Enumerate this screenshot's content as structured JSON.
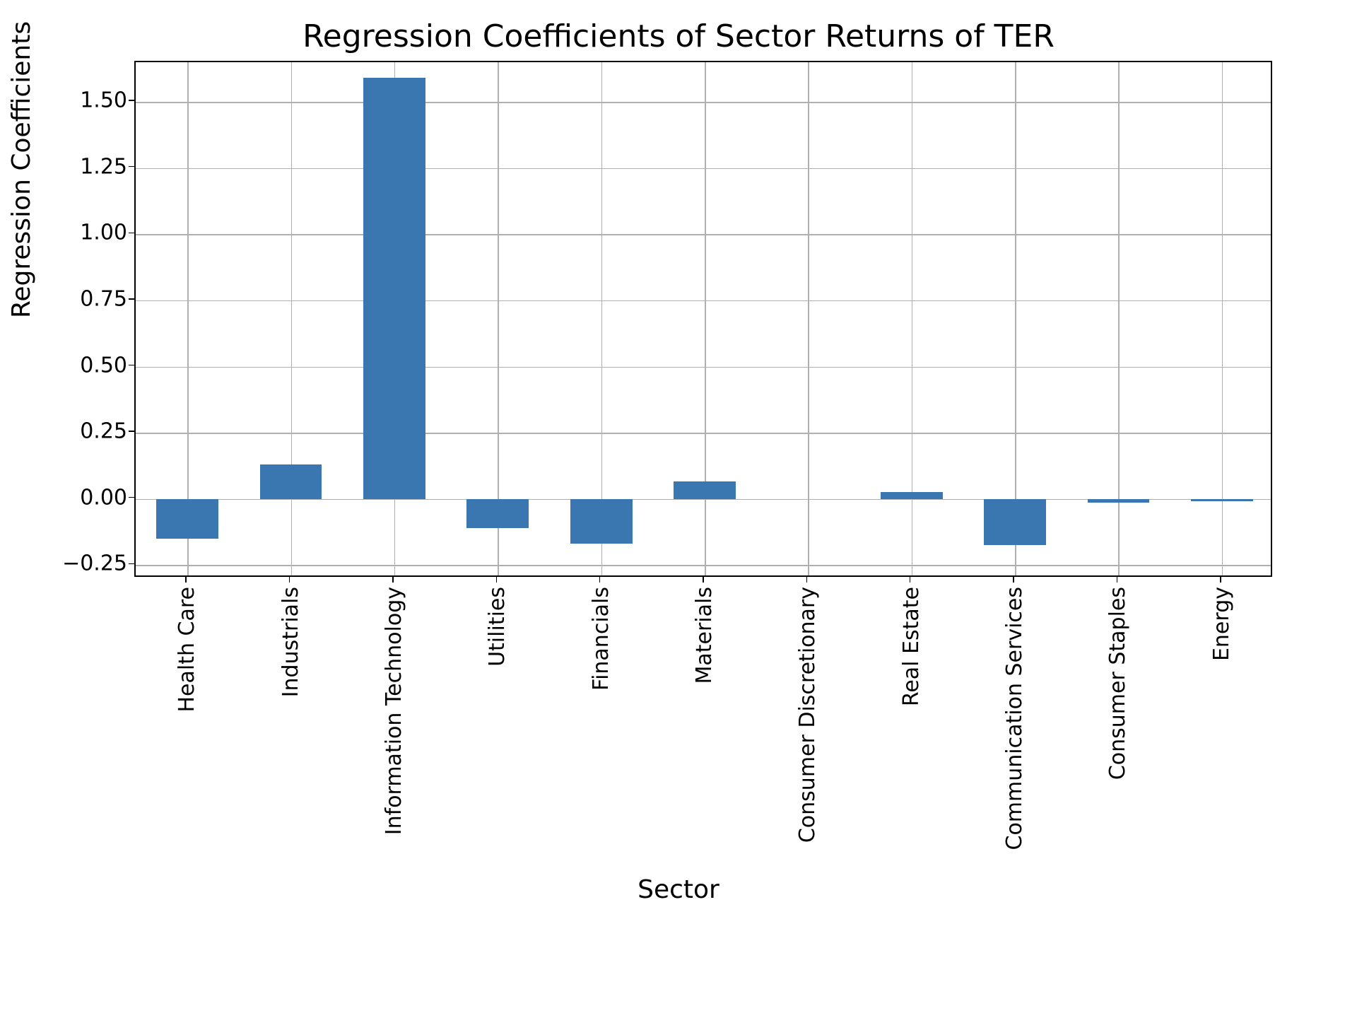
{
  "chart_data": {
    "type": "bar",
    "title": "Regression Coefficients of Sector Returns of TER",
    "xlabel": "Sector",
    "ylabel": "Regression Coefficients",
    "categories": [
      "Health Care",
      "Industrials",
      "Information Technology",
      "Utilities",
      "Financials",
      "Materials",
      "Consumer Discretionary",
      "Real Estate",
      "Communication Services",
      "Consumer Staples",
      "Energy"
    ],
    "values": [
      -0.15,
      0.13,
      1.59,
      -0.11,
      -0.17,
      0.065,
      0.0,
      0.025,
      -0.175,
      -0.015,
      -0.01
    ],
    "ylim": [
      -0.3,
      1.65
    ],
    "yticks": [
      -0.25,
      0.0,
      0.25,
      0.5,
      0.75,
      1.0,
      1.25,
      1.5
    ],
    "ytick_labels": [
      "−0.25",
      "0.00",
      "0.25",
      "0.50",
      "0.75",
      "1.00",
      "1.25",
      "1.50"
    ],
    "bar_color": "#3a76af",
    "grid": true
  }
}
